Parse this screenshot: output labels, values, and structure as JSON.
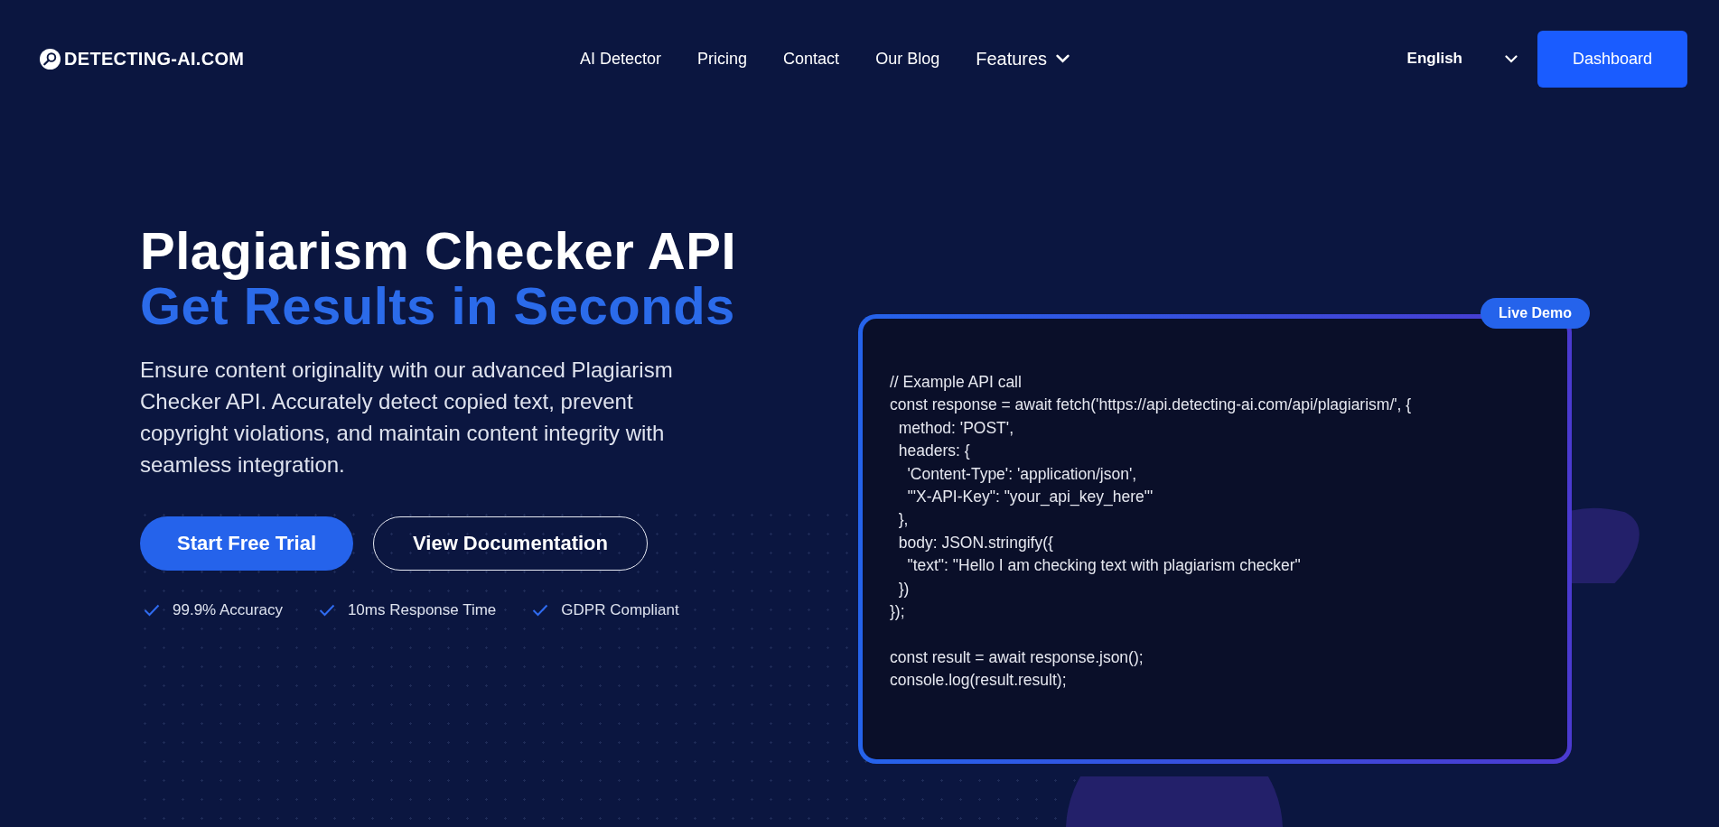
{
  "logo": {
    "text": "DETECTING-AI.COM"
  },
  "nav": [
    {
      "label": "AI Detector",
      "kind": "link"
    },
    {
      "label": "Pricing",
      "kind": "link"
    },
    {
      "label": "Contact",
      "kind": "link"
    },
    {
      "label": "Our Blog",
      "kind": "link"
    },
    {
      "label": "Features",
      "kind": "dropdown"
    }
  ],
  "language": {
    "value": "English"
  },
  "dashboard_button": "Dashboard",
  "hero": {
    "title": "Plagiarism Checker API",
    "subtitle": "Get Results in Seconds",
    "description": "Ensure content originality with our advanced Plagiarism Checker API. Accurately detect copied text, prevent copyright violations, and maintain content integrity with seamless integration.",
    "buttons": [
      {
        "label": "Start Free Trial",
        "kind": "primary"
      },
      {
        "label": "View Documentation",
        "kind": "outline"
      }
    ],
    "features": [
      "99.9% Accuracy",
      "10ms Response Time",
      "GDPR Compliant"
    ]
  },
  "demo": {
    "badge": "Live Demo",
    "code": [
      [
        "// Example API call",
        "const response = await fetch('https://api.detecting-ai.com/api/plagiarism/', {",
        "  method: 'POST',",
        "  headers: {",
        "    'Content-Type': 'application/json',",
        "    '\"X-API-Key\": \"your_api_key_here\"'",
        "  },",
        "  body: JSON.stringify({",
        "    \"text\": \"Hello I am checking text with plagiarism checker\"",
        "  })",
        "});"
      ],
      [
        "const result = await response.json();",
        "console.log(result.result);"
      ]
    ]
  }
}
